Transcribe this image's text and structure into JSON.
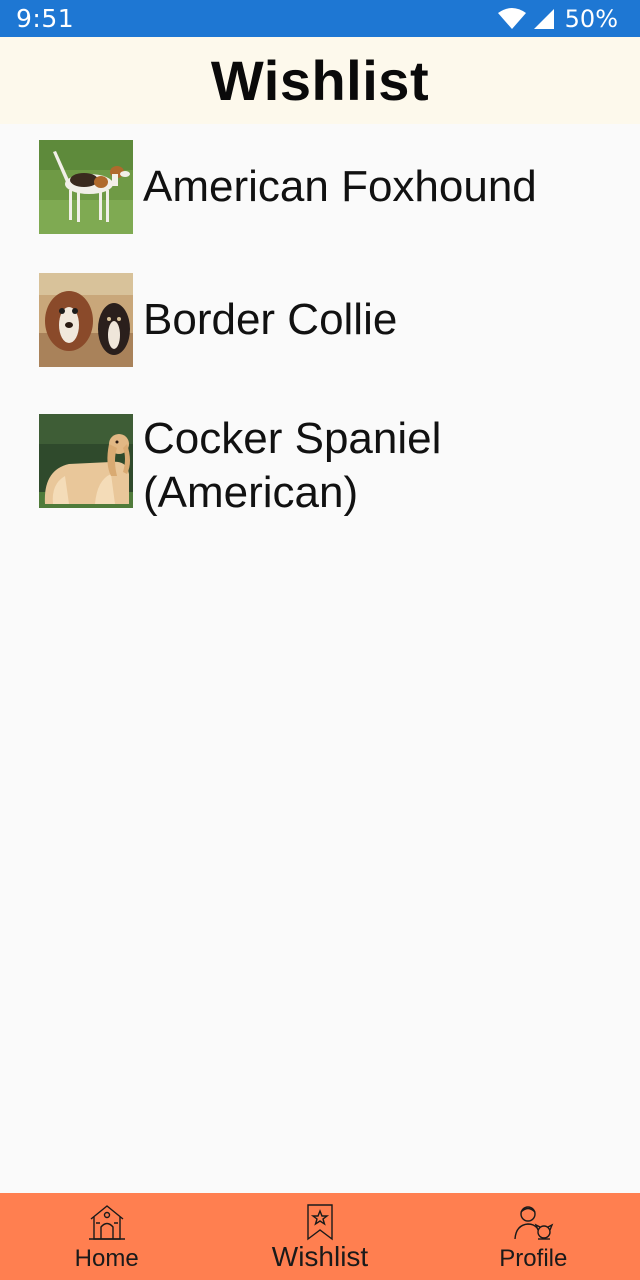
{
  "status_bar": {
    "time": "9:51",
    "battery": "50%",
    "icons": [
      "wifi-icon",
      "signal-icon"
    ],
    "color": "#1e77d3"
  },
  "header": {
    "title": "Wishlist",
    "background": "#fdf9ec"
  },
  "wishlist": {
    "items": [
      {
        "name": "American Foxhound",
        "thumbnail": "american-foxhound-photo"
      },
      {
        "name": "Border Collie",
        "thumbnail": "border-collie-photo"
      },
      {
        "name_line1": "Cocker Spaniel",
        "name_line2": "(American)",
        "thumbnail": "cocker-spaniel-photo"
      }
    ]
  },
  "bottom_nav": {
    "background": "#ff7f50",
    "items": [
      {
        "label": "Home",
        "icon": "doghouse-icon"
      },
      {
        "label": "Wishlist",
        "icon": "bookmark-star-icon",
        "active": true
      },
      {
        "label": "Profile",
        "icon": "person-with-dog-icon"
      }
    ]
  }
}
